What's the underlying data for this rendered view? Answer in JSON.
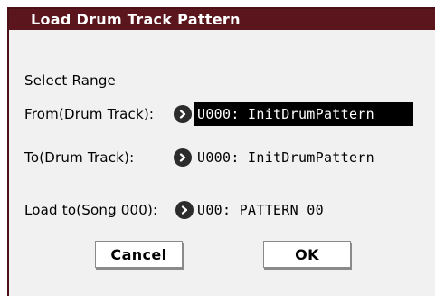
{
  "dialog": {
    "title": "Load Drum Track Pattern"
  },
  "section_label": "Select Range",
  "fields": {
    "from": {
      "label": "From(Drum Track):",
      "value": "U000: InitDrumPattern"
    },
    "to": {
      "label": "To(Drum Track):",
      "value": "U000: InitDrumPattern"
    },
    "load_to": {
      "label": "Load to(Song 000):",
      "value": "U00: PATTERN 00"
    }
  },
  "buttons": {
    "cancel": "Cancel",
    "ok": "OK"
  },
  "icons": {
    "popup": "chevron-right-circle-icon"
  },
  "colors": {
    "titlebar": "#5b151c",
    "dialog_bg": "#f1f1f1",
    "selected_bg": "#000000"
  }
}
